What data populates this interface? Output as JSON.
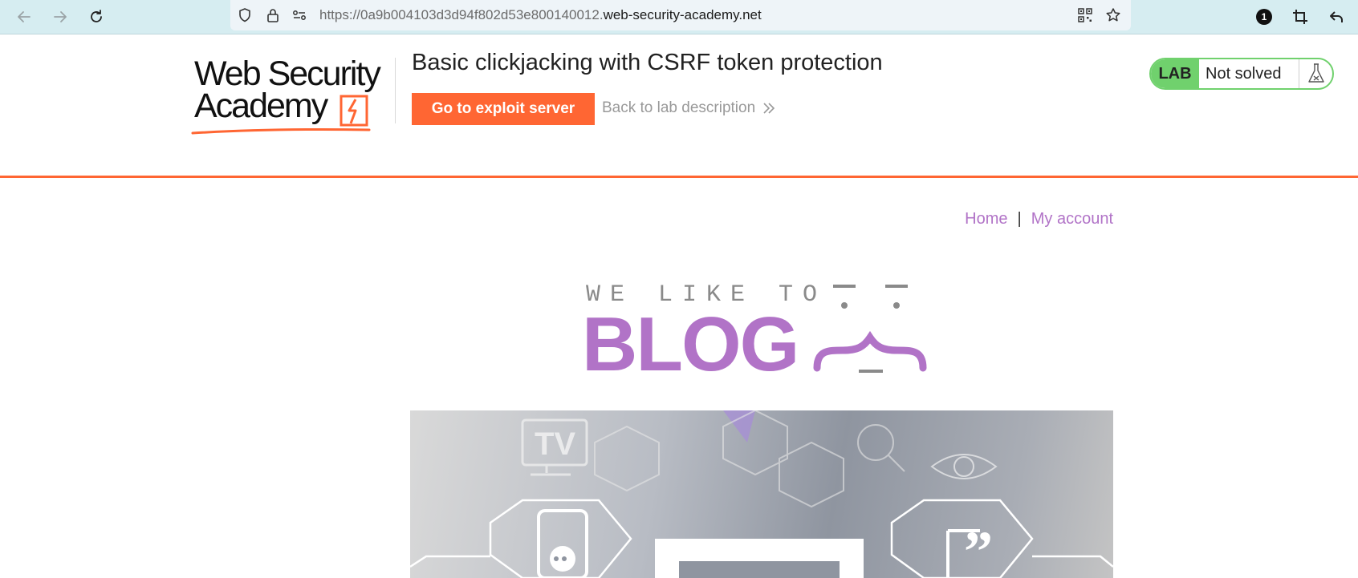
{
  "browser": {
    "url_prefix": "https://0a9b004103d3d94f802d53e800140012.",
    "url_domain": "web-security-academy.net",
    "extension_badge": "1"
  },
  "lab_header": {
    "logo_line1": "Web Security",
    "logo_line2": "Academy",
    "title": "Basic clickjacking with CSRF token protection",
    "exploit_button": "Go to exploit server",
    "back_link": "Back to lab description",
    "lab_tag": "LAB",
    "status": "Not solved"
  },
  "nav": {
    "home": "Home",
    "separator": "|",
    "account": "My account"
  },
  "blog_logo": {
    "tagline": "WE LIKE TO",
    "word": "BLOG"
  },
  "hero": {
    "tv_label": "TV"
  },
  "colors": {
    "accent_orange": "#ff6633",
    "blog_purple": "#b173c7",
    "lab_green": "#70d16d"
  }
}
